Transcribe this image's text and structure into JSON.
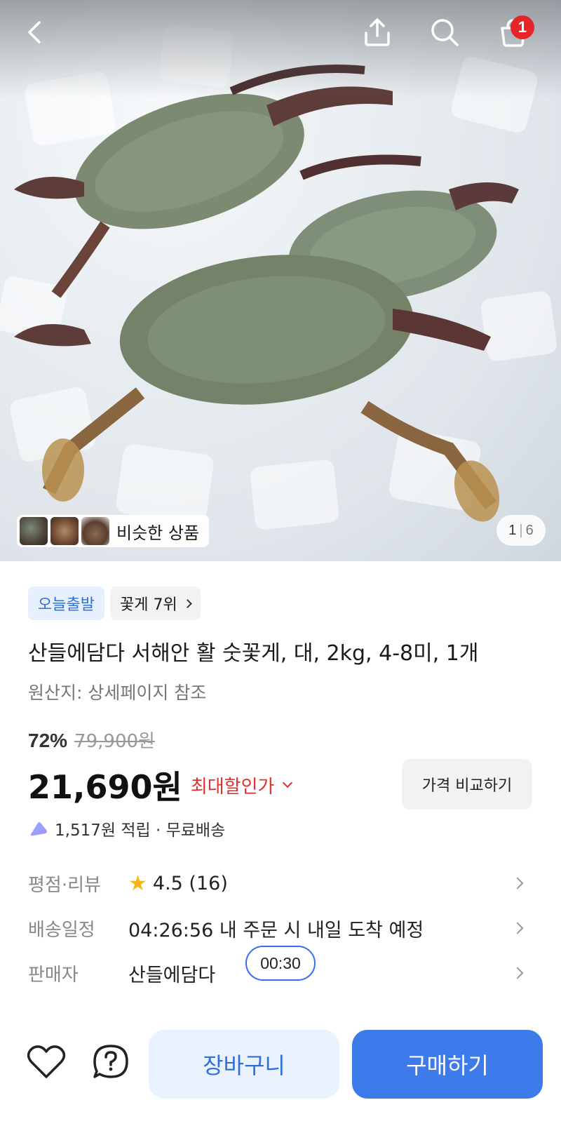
{
  "header": {
    "back_icon": "back-arrow-icon",
    "share_icon": "share-icon",
    "search_icon": "search-icon",
    "cart_icon": "shopping-bag-icon",
    "cart_count": "1"
  },
  "gallery": {
    "similar_label": "비슷한 상품",
    "current": "1",
    "separator": "|",
    "total": "6"
  },
  "product": {
    "tags": [
      {
        "label": "오늘출발"
      },
      {
        "label": "꽃게 7위"
      }
    ],
    "title": "산들에담다 서해안 활 숫꽃게, 대, 2kg, 4-8미, 1개",
    "origin": "원산지: 상세페이지 참조",
    "discount_percent": "72%",
    "original_price": "79,900원",
    "price": "21,690원",
    "max_discount_label": "최대할인가",
    "compare_label": "가격 비교하기",
    "points_text": "1,517원 적립 · 무료배송"
  },
  "info_rows": [
    {
      "label": "평점·리뷰",
      "value": "4.5 (16)"
    },
    {
      "label": "배송일정",
      "value": "04:26:56 내 주문 시 내일 도착 예정"
    },
    {
      "label": "판매자",
      "value": "산들에담다"
    }
  ],
  "timer_badge": "00:30",
  "bottom": {
    "wishlist_icon": "heart-icon",
    "qa_icon": "question-icon",
    "cart_button": "장바구니",
    "buy_button": "구매하기"
  },
  "colors": {
    "accent_blue": "#3d7bea",
    "tag_blue_text": "#2f6fd6",
    "discount_red": "#e03030",
    "badge_red": "#e5252a",
    "star": "#f6b519"
  }
}
